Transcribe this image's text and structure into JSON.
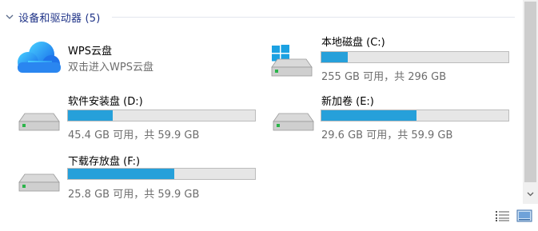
{
  "group": {
    "title": "设备和驱动器 (5)"
  },
  "drives": [
    {
      "name": "WPS云盘",
      "sub": "双击进入WPS云盘",
      "icon": "cloud-icon"
    },
    {
      "name": "本地磁盘 (C:)",
      "sub": "255 GB 可用，共 296 GB",
      "used_fraction": 0.14,
      "icon": "windows-drive-icon"
    },
    {
      "name": "软件安装盘 (D:)",
      "sub": "45.4 GB 可用，共 59.9 GB",
      "used_fraction": 0.24,
      "icon": "hard-drive-icon"
    },
    {
      "name": "新加卷 (E:)",
      "sub": "29.6 GB 可用，共 59.9 GB",
      "used_fraction": 0.51,
      "icon": "hard-drive-icon"
    },
    {
      "name": "下载存放盘 (F:)",
      "sub": "25.8 GB 可用，共 59.9 GB",
      "used_fraction": 0.57,
      "icon": "hard-drive-icon"
    }
  ],
  "colors": {
    "bar_fill": "#26a0da",
    "bar_track": "#e6e6e6",
    "header_text": "#1e3287"
  }
}
